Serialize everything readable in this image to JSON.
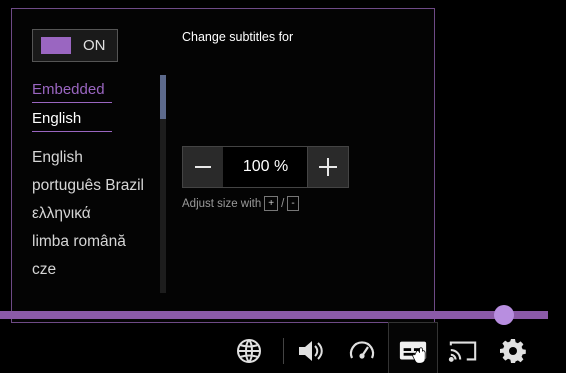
{
  "subtitles": {
    "toggle_label": "ON",
    "tabs": [
      "Embedded",
      "English"
    ],
    "languages": [
      "English",
      "português Brazil",
      "ελληνικά",
      "limba română",
      "cze"
    ],
    "title": "Change subtitles for",
    "size": {
      "value": "100 %",
      "hint": "Adjust size with",
      "key_plus": "+",
      "key_minus": "-",
      "separator": "/"
    }
  },
  "player": {
    "progress_fraction": 0.9,
    "accent": "#9a66c1",
    "controls": [
      "globe-icon",
      "volume-icon",
      "speed-icon",
      "subtitles-icon",
      "cast-icon",
      "settings-icon"
    ]
  }
}
